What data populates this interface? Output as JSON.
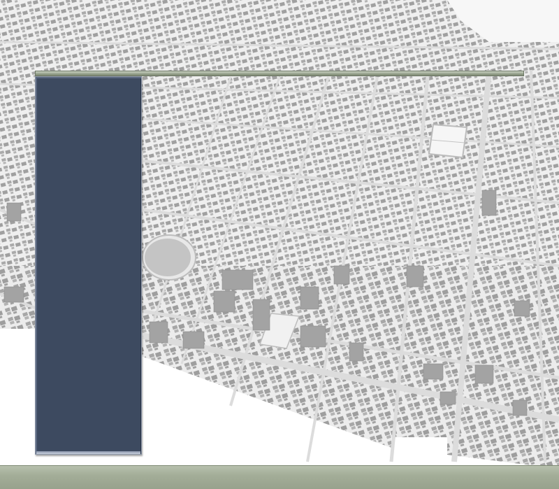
{
  "scene": {
    "background": "city-aerial-3d-map",
    "colors": {
      "map_background": "#f4f4f4",
      "road": "#d8d8d8",
      "building": "#a9a9a9",
      "panel": "#3d4a60",
      "bar_green": "#97a18c"
    }
  }
}
